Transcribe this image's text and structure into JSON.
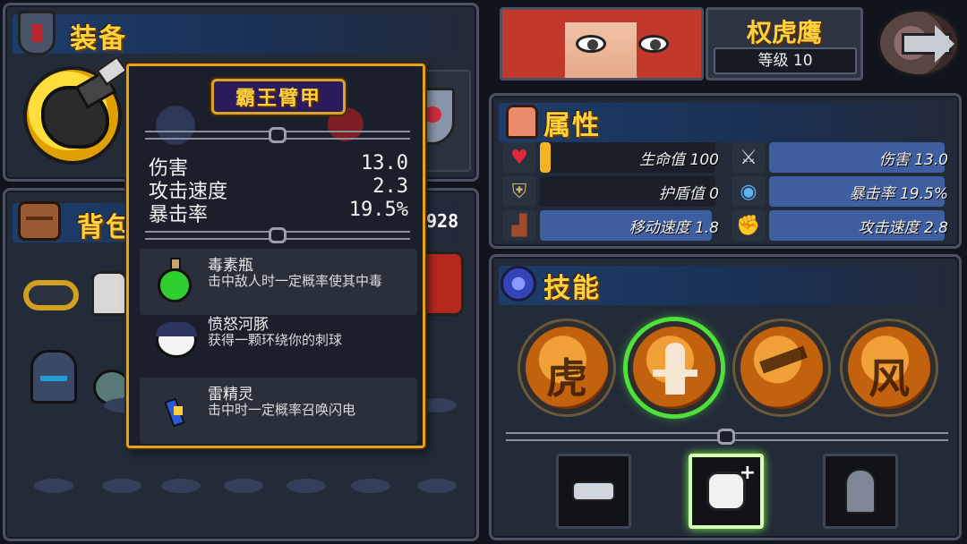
{
  "equipment": {
    "title": "装备"
  },
  "backpack": {
    "title": "背包",
    "coins": "928"
  },
  "tooltip": {
    "item_name": "霸王臂甲",
    "stats": [
      {
        "label": "伤害",
        "value": "13.0"
      },
      {
        "label": "攻击速度",
        "value": "2.3"
      },
      {
        "label": "暴击率",
        "value": "19.5%"
      }
    ],
    "abilities": [
      {
        "name": "毒素瓶",
        "desc": "击中敌人时一定概率使其中毒"
      },
      {
        "name": "愤怒河豚",
        "desc": "获得一颗环绕你的刺球"
      },
      {
        "name": "雷精灵",
        "desc": "击中时一定概率召唤闪电"
      }
    ]
  },
  "character": {
    "name": "权虎鹰",
    "level": "等级 10"
  },
  "attributes": {
    "title": "属性",
    "items": [
      {
        "label": "生命值 100",
        "icon": "heart-icon",
        "fill": 0.06,
        "color": "#f2b41f"
      },
      {
        "label": "伤害 13.0",
        "icon": "sword-icon",
        "fill": 0.97,
        "color": "#3e5ea0"
      },
      {
        "label": "护盾值 0",
        "icon": "shield-icon",
        "fill": 0,
        "color": "#3e5ea0"
      },
      {
        "label": "暴击率 19.5%",
        "icon": "eye-icon",
        "fill": 0.97,
        "color": "#3e5ea0"
      },
      {
        "label": "移动速度 1.8",
        "icon": "boot-icon",
        "fill": 0.95,
        "color": "#3e5ea0"
      },
      {
        "label": "攻击速度 2.8",
        "icon": "fist-icon",
        "fill": 0.97,
        "color": "#3e5ea0"
      }
    ]
  },
  "skills": {
    "title": "技能",
    "orbs": [
      {
        "glyph": "虎",
        "active": false
      },
      {
        "glyph": "",
        "active": true
      },
      {
        "glyph": "",
        "active": false
      },
      {
        "glyph": "风",
        "active": false
      }
    ]
  }
}
